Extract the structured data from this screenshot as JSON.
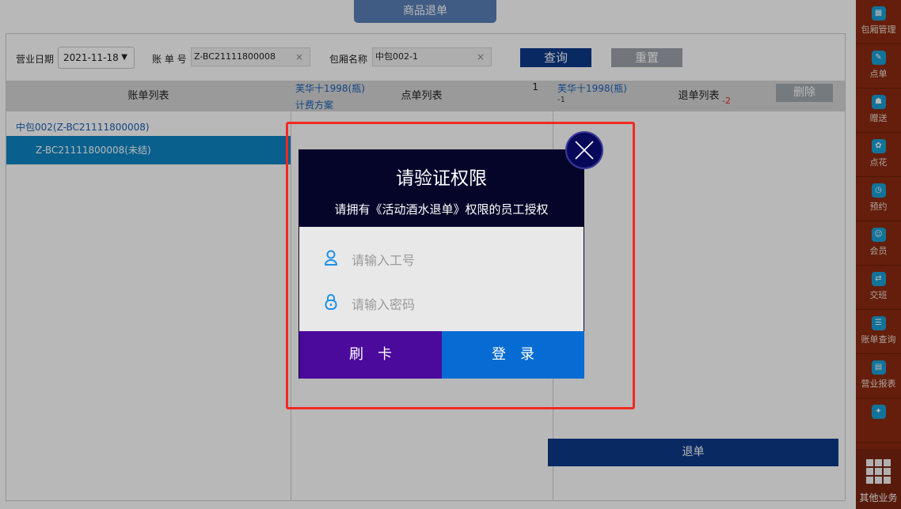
{
  "header": {
    "title": "商品退单"
  },
  "filter": {
    "date_label": "营业日期",
    "date_value": "2021-11-18",
    "bill_label": "账 单 号",
    "bill_value": "Z-BC21111800008",
    "room_label": "包厢名称",
    "room_value": "中包002-1",
    "query_label": "查询",
    "reset_label": "重置"
  },
  "columns": {
    "bills": "账单列表",
    "orders": "点单列表",
    "refunds": "退单列表"
  },
  "bills": {
    "group": "中包002(Z-BC21111800008)",
    "selected": "Z-BC21111800008(未结)"
  },
  "orders": {
    "item_name": "芙华十1998(瓶)",
    "item_qty": "1",
    "plan": "计费方案"
  },
  "refunds": {
    "item_name": "芙华十1998(瓶)",
    "item_sub": "-1",
    "item_qty": "-2",
    "delete_label": "删除",
    "refund_label": "退单"
  },
  "sidebar": {
    "items": [
      {
        "label": "包厢管理",
        "icon": "grid-icon"
      },
      {
        "label": "点单",
        "icon": "order-icon"
      },
      {
        "label": "赠送",
        "icon": "gift-icon"
      },
      {
        "label": "点花",
        "icon": "flower-icon"
      },
      {
        "label": "预约",
        "icon": "reserve-icon"
      },
      {
        "label": "会员",
        "icon": "member-icon"
      },
      {
        "label": "交班",
        "icon": "shift-icon"
      },
      {
        "label": "账单查询",
        "icon": "bill-query-icon"
      },
      {
        "label": "营业报表",
        "icon": "report-icon"
      }
    ],
    "more_label": "其他业务"
  },
  "dialog": {
    "title": "请验证权限",
    "subtitle": "请拥有《活动酒水退单》权限的员工授权",
    "employee_placeholder": "请输入工号",
    "password_placeholder": "请输入密码",
    "card_label": "刷卡",
    "login_label": "登录"
  },
  "colors": {
    "accent_navy": "#0d3a8a",
    "selected_row": "#0d85c4",
    "dialog_head": "#05052a",
    "card_button": "#4b0a9c",
    "login_button": "#066cd4",
    "sidebar": "#8b2a10",
    "highlight": "#f12a22"
  }
}
